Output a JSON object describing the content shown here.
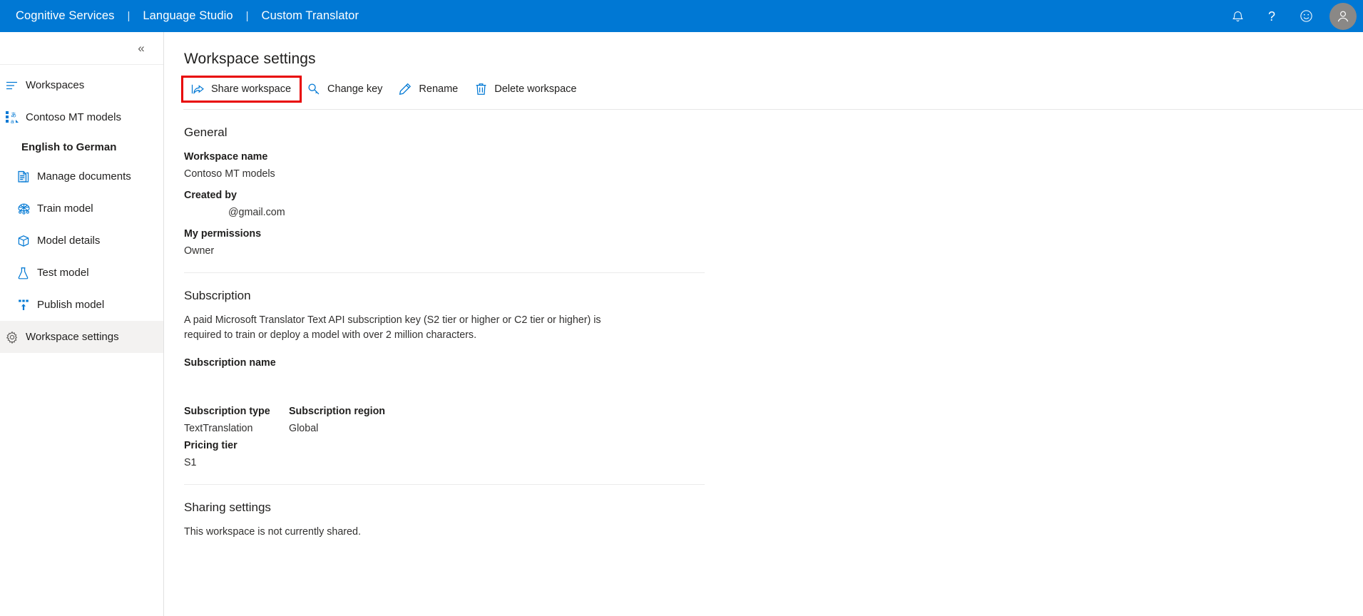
{
  "topbar": {
    "links": [
      {
        "label": "Cognitive Services",
        "name": "cognitive-services-link"
      },
      {
        "label": "Language Studio",
        "name": "language-studio-link"
      },
      {
        "label": "Custom Translator",
        "name": "custom-translator-link"
      }
    ],
    "separator": "|",
    "icons": [
      {
        "name": "notification-bell-icon",
        "label": "Notifications"
      },
      {
        "name": "help-question-icon",
        "label": "Help"
      },
      {
        "name": "feedback-smiley-icon",
        "label": "Feedback"
      }
    ],
    "avatar": {
      "name": "user-avatar",
      "label": "Account"
    },
    "brand_color": "#0078d4"
  },
  "sidebar": {
    "collapse_label": "«",
    "items": [
      {
        "label": "Workspaces",
        "icon": "list-icon",
        "name": "sidebar-item-workspaces",
        "type": "nav",
        "selected": false
      },
      {
        "label": "Contoso MT models",
        "icon": "translate-icon",
        "name": "sidebar-item-contoso-mt-models",
        "type": "nav",
        "selected": false
      },
      {
        "label": "English to German",
        "icon": "",
        "name": "sidebar-item-english-to-german",
        "type": "subheading",
        "selected": false
      },
      {
        "label": "Manage documents",
        "icon": "document-icon",
        "name": "sidebar-item-manage-documents",
        "type": "child",
        "selected": false
      },
      {
        "label": "Train model",
        "icon": "neural-network-icon",
        "name": "sidebar-item-train-model",
        "type": "child",
        "selected": false
      },
      {
        "label": "Model details",
        "icon": "cube-icon",
        "name": "sidebar-item-model-details",
        "type": "child",
        "selected": false
      },
      {
        "label": "Test model",
        "icon": "flask-icon",
        "name": "sidebar-item-test-model",
        "type": "child",
        "selected": false
      },
      {
        "label": "Publish model",
        "icon": "publish-upload-icon",
        "name": "sidebar-item-publish-model",
        "type": "child",
        "selected": false
      },
      {
        "label": "Workspace settings",
        "icon": "gear-icon",
        "name": "sidebar-item-workspace-settings",
        "type": "nav",
        "selected": true
      }
    ]
  },
  "page": {
    "title": "Workspace settings"
  },
  "toolbar": {
    "commands": [
      {
        "label": "Share workspace",
        "icon": "share-icon",
        "name": "share-workspace-button",
        "highlighted": true
      },
      {
        "label": "Change key",
        "icon": "key-icon",
        "name": "change-key-button",
        "highlighted": false
      },
      {
        "label": "Rename",
        "icon": "pencil-icon",
        "name": "rename-button",
        "highlighted": false
      },
      {
        "label": "Delete workspace",
        "icon": "trash-icon",
        "name": "delete-workspace-button",
        "highlighted": false
      }
    ],
    "highlight_color": "#e80000"
  },
  "general": {
    "title": "General",
    "workspace_name_label": "Workspace name",
    "workspace_name_value": "Contoso MT models",
    "created_by_label": "Created by",
    "created_by_value": "@gmail.com",
    "my_permissions_label": "My permissions",
    "my_permissions_value": "Owner"
  },
  "subscription": {
    "title": "Subscription",
    "description": "A paid Microsoft Translator Text API subscription key (S2 tier or higher or C2 tier or higher) is required to train or deploy a model with over 2 million characters.",
    "subscription_name_label": "Subscription name",
    "subscription_name_value": "",
    "subscription_type_label": "Subscription type",
    "subscription_type_value": "TextTranslation",
    "subscription_region_label": "Subscription region",
    "subscription_region_value": "Global",
    "pricing_tier_label": "Pricing tier",
    "pricing_tier_value": "S1"
  },
  "sharing": {
    "title": "Sharing settings",
    "status": "This workspace is not currently shared."
  }
}
